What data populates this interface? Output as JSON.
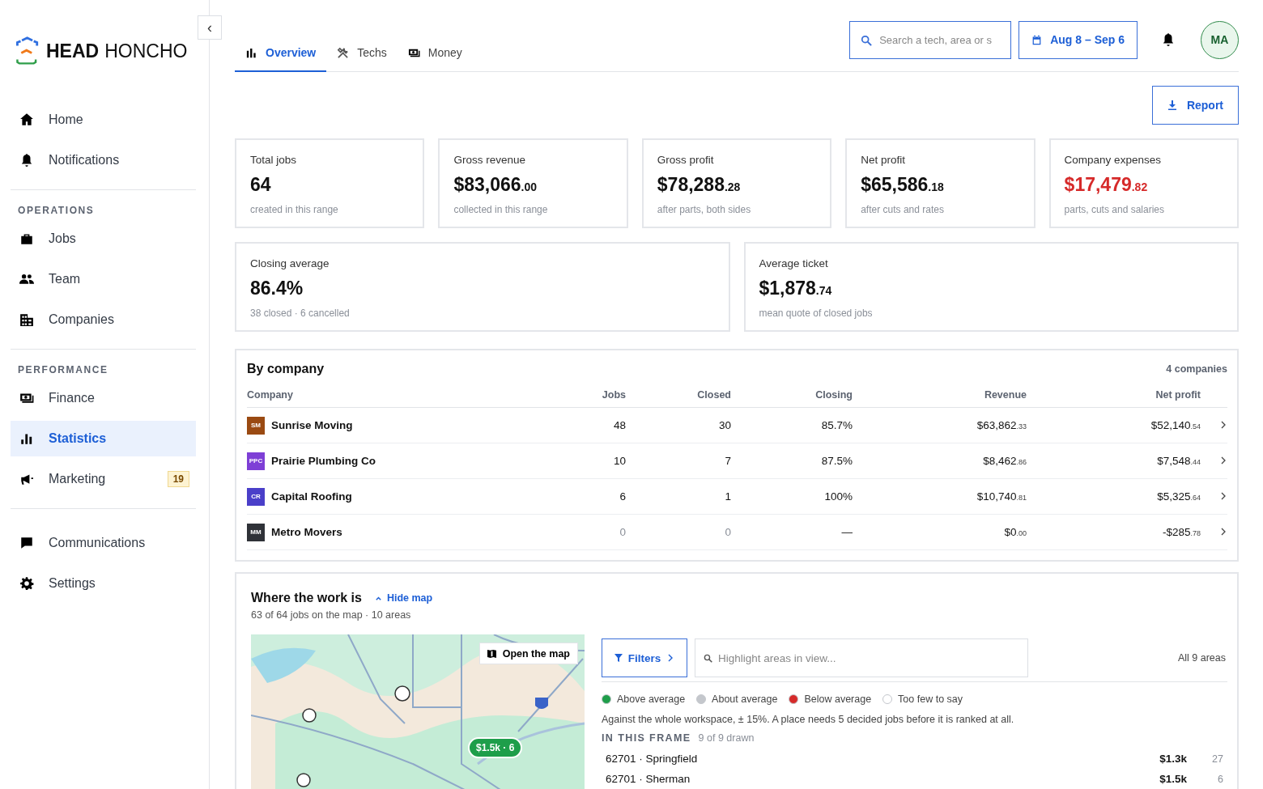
{
  "brand": {
    "name_bold": "HEAD",
    "name_light": "HONCHO"
  },
  "collapse": {
    "label": "‹"
  },
  "sidebar": {
    "sections": [
      {
        "items": [
          {
            "label": "Home",
            "selected": false
          },
          {
            "label": "Notifications",
            "selected": false
          }
        ]
      },
      {
        "heading": "OPERATIONS",
        "items": [
          {
            "label": "Jobs",
            "selected": false
          },
          {
            "label": "Team",
            "selected": false
          },
          {
            "label": "Companies",
            "selected": false
          }
        ]
      },
      {
        "heading": "PERFORMANCE",
        "items": [
          {
            "label": "Finance",
            "selected": false
          },
          {
            "label": "Statistics",
            "selected": true
          },
          {
            "label": "Marketing",
            "selected": false,
            "badge": "19"
          }
        ]
      },
      {
        "items": [
          {
            "label": "Communications",
            "selected": false
          },
          {
            "label": "Settings",
            "selected": false
          }
        ]
      }
    ]
  },
  "tabs": [
    {
      "label": "Overview",
      "selected": true
    },
    {
      "label": "Techs",
      "selected": false
    },
    {
      "label": "Money",
      "selected": false
    }
  ],
  "search": {
    "placeholder": "Search a tech, area or s"
  },
  "date_range": {
    "label": "Aug 8 – Sep 6"
  },
  "avatar": {
    "initials": "MA"
  },
  "report_button": {
    "label": "Report"
  },
  "stats": [
    {
      "label": "Total jobs",
      "value": "64",
      "note": "created in this range",
      "highlight": false
    },
    {
      "label": "Gross revenue",
      "value": "$83,066",
      "cents": ".00",
      "note": "collected in this range",
      "highlight": false
    },
    {
      "label": "Gross profit",
      "value": "$78,288",
      "cents": ".28",
      "note": "after parts, both sides",
      "highlight": false
    },
    {
      "label": "Net profit",
      "value": "$65,586",
      "cents": ".18",
      "note": "after cuts and rates",
      "highlight": false
    },
    {
      "label": "Company expenses",
      "value": "$17,479",
      "cents": ".82",
      "note": "parts, cuts and salaries",
      "highlight": true
    }
  ],
  "stats_wide": [
    {
      "label": "Closing average",
      "value": "86.4%",
      "note": "38 closed · 6 cancelled",
      "highlight": false
    },
    {
      "label": "Average ticket",
      "value": "$1,878",
      "cents": ".74",
      "note": "mean quote of closed jobs",
      "highlight": false
    }
  ],
  "by_company": {
    "title": "By company",
    "count": "4 companies",
    "columns": [
      "Company",
      "Jobs",
      "Closed",
      "Closing",
      "Revenue",
      "Net profit"
    ],
    "rows": [
      {
        "initials": "SM",
        "color": "#9a4a12",
        "name": "Sunrise Moving",
        "jobs": "48",
        "closed": "30",
        "closing": "85.7%",
        "revenue": "$63,862",
        "revenue_cents": ".33",
        "net": "$52,140",
        "net_cents": ".54",
        "empty": false
      },
      {
        "initials": "PPC",
        "color": "#7e3fd6",
        "name": "Prairie Plumbing Co",
        "jobs": "10",
        "closed": "7",
        "closing": "87.5%",
        "revenue": "$8,462",
        "revenue_cents": ".86",
        "net": "$7,548",
        "net_cents": ".44",
        "empty": false
      },
      {
        "initials": "CR",
        "color": "#4a3fc9",
        "name": "Capital Roofing",
        "jobs": "6",
        "closed": "1",
        "closing": "100%",
        "revenue": "$10,740",
        "revenue_cents": ".81",
        "net": "$5,325",
        "net_cents": ".64",
        "empty": false
      },
      {
        "initials": "MM",
        "color": "#2f3238",
        "name": "Metro Movers",
        "jobs": "0",
        "closed": "0",
        "closing": "—",
        "revenue": "$0",
        "revenue_cents": ".00",
        "net": "-$285",
        "net_cents": ".78",
        "empty": true
      }
    ]
  },
  "map_section": {
    "title": "Where the work is",
    "toggle": "Hide map",
    "subtitle": "63 of 64 jobs on the map · 10 areas",
    "open_map": "Open the map",
    "marker": "$1.5k · 6",
    "filters": "Filters",
    "highlight_placeholder": "Highlight areas in view...",
    "areas_count": "All 9 areas",
    "legend": [
      {
        "label": "Above average",
        "color": "#1e9e4a"
      },
      {
        "label": "About average",
        "color": "#c4c7cc"
      },
      {
        "label": "Below average",
        "color": "#d62a2a"
      },
      {
        "label": "Too few to say",
        "color": "#ffffff"
      }
    ],
    "note": "Against the whole workspace, ± 15%. A place needs 5 decided jobs before it is ranked at all.",
    "frame_heading": "IN THIS FRAME",
    "frame_count": "9 of 9 drawn",
    "areas": [
      {
        "name": "62701 · Springfield",
        "amount": "$1.3k",
        "jobs": "27"
      },
      {
        "name": "62701 · Sherman",
        "amount": "$1.5k",
        "jobs": "6"
      }
    ]
  }
}
